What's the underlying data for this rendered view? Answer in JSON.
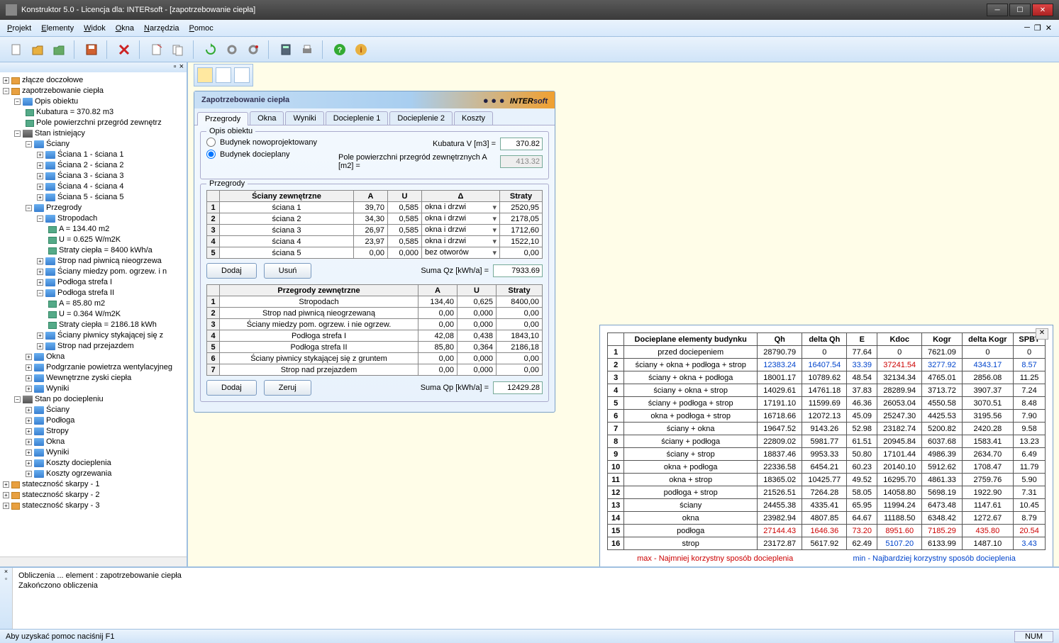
{
  "title": "Konstruktor 5.0 - Licencja dla: INTERsoft - [zapotrzebowanie ciepła]",
  "menu": {
    "projekt": "Projekt",
    "elementy": "Elementy",
    "widok": "Widok",
    "okna": "Okna",
    "narzedzia": "Narzędzia",
    "pomoc": "Pomoc"
  },
  "panel": {
    "title": "Zapotrzebowanie ciepła",
    "brand_a": "INTER",
    "brand_b": "soft",
    "tabs": {
      "przegrody": "Przegrody",
      "okna": "Okna",
      "wyniki": "Wyniki",
      "doc1": "Docieplenie 1",
      "doc2": "Docieplenie 2",
      "koszty": "Koszty"
    },
    "opis": {
      "title": "Opis obiektu",
      "r1": "Budynek nowoprojektowany",
      "r2": "Budynek docieplany",
      "kubatura_lbl": "Kubatura   V [m3] =",
      "kubatura": "370.82",
      "pole_lbl": "Pole powierzchni przegród zewnętrznych   A [m2] =",
      "pole": "413.32"
    },
    "prz": {
      "title": "Przegrody",
      "h1": "Ściany zewnętrzne",
      "hA": "A",
      "hU": "U",
      "hD": "Δ",
      "hS": "Straty",
      "rows": [
        {
          "n": "1",
          "name": "ściana 1",
          "a": "39,70",
          "u": "0,585",
          "d": "okna i drzwi",
          "s": "2520,95"
        },
        {
          "n": "2",
          "name": "ściana 2",
          "a": "34,30",
          "u": "0,585",
          "d": "okna i drzwi",
          "s": "2178,05"
        },
        {
          "n": "3",
          "name": "ściana 3",
          "a": "26,97",
          "u": "0,585",
          "d": "okna i drzwi",
          "s": "1712,60"
        },
        {
          "n": "4",
          "name": "ściana 4",
          "a": "23,97",
          "u": "0,585",
          "d": "okna i drzwi",
          "s": "1522,10"
        },
        {
          "n": "5",
          "name": "ściana 5",
          "a": "0,00",
          "u": "0,000",
          "d": "bez otworów",
          "s": "0,00"
        }
      ],
      "dodaj": "Dodaj",
      "usun": "Usuń",
      "suma_lbl": "Suma Qz [kWh/a] =",
      "suma": "7933.69",
      "h2": "Przegrody zewnętrzne",
      "rows2": [
        {
          "n": "1",
          "name": "Stropodach",
          "a": "134,40",
          "u": "0,625",
          "s": "8400,00"
        },
        {
          "n": "2",
          "name": "Strop nad piwnicą nieogrzewaną",
          "a": "0,00",
          "u": "0,000",
          "s": "0,00"
        },
        {
          "n": "3",
          "name": "Ściany miedzy pom. ogrzew. i nie ogrzew.",
          "a": "0,00",
          "u": "0,000",
          "s": "0,00"
        },
        {
          "n": "4",
          "name": "Podłoga strefa I",
          "a": "42,08",
          "u": "0,438",
          "s": "1843,10"
        },
        {
          "n": "5",
          "name": "Podłoga strefa II",
          "a": "85,80",
          "u": "0,364",
          "s": "2186,18"
        },
        {
          "n": "6",
          "name": "Ściany piwnicy stykającej się z gruntem",
          "a": "0,00",
          "u": "0,000",
          "s": "0,00"
        },
        {
          "n": "7",
          "name": "Strop nad przejazdem",
          "a": "0,00",
          "u": "0,000",
          "s": "0,00"
        }
      ],
      "zeruj": "Zeruj",
      "suma2_lbl": "Suma Qp [kWh/a] =",
      "suma2": "12429.28"
    }
  },
  "tree": {
    "n1": "złącze doczołowe",
    "n2": "zapotrzebowanie ciepła",
    "n3": "Opis obiektu",
    "n4": "Kubatura = 370.82 m3",
    "n5": "Pole powierzchni przegród zewnętrz",
    "n6": "Stan istniejący",
    "n7": "Ściany",
    "s1": "Ściana 1 - ściana 1",
    "s2": "Ściana 2 - ściana 2",
    "s3": "Ściana 3 - ściana 3",
    "s4": "Ściana 4 - ściana 4",
    "s5": "Ściana 5 - ściana 5",
    "n8": "Przegrody",
    "n9": "Stropodach",
    "n9a": "A = 134.40 m2",
    "n9b": "U = 0.625 W/m2K",
    "n9c": "Straty ciepła = 8400 kWh/a",
    "n10": "Strop nad piwnicą nieogrzewa",
    "n11": "Ściany miedzy pom. ogrzew. i n",
    "n12": "Podłoga strefa I",
    "n13": "Podłoga strefa II",
    "n13a": "A = 85.80 m2",
    "n13b": "U = 0.364 W/m2K",
    "n13c": "Straty ciepła = 2186.18 kWh",
    "n14": "Ściany piwnicy stykającej się z",
    "n15": "Strop nad przejazdem",
    "n16": "Okna",
    "n17": "Podgrzanie powietrza wentylacyjneg",
    "n18": "Wewnętrzne zyski ciepła",
    "n19": "Wyniki",
    "n20": "Stan po dociepleniu",
    "n21": "Ściany",
    "n22": "Podłoga",
    "n23": "Stropy",
    "n24": "Okna",
    "n25": "Wyniki",
    "n26": "Koszty docieplenia",
    "n27": "Koszty ogrzewania",
    "n28": "stateczność skarpy - 1",
    "n29": "stateczność skarpy - 2",
    "n30": "stateczność skarpy - 3"
  },
  "results": {
    "headers": {
      "el": "Docieplane elementy budynku",
      "qh": "Qh",
      "dqh": "delta Qh",
      "e": "E",
      "kdoc": "Kdoc",
      "kogr": "Kogr",
      "dkogr": "delta Kogr",
      "spbt": "SPBT"
    },
    "rows": [
      {
        "n": "1",
        "el": "przed dociepeniem",
        "qh": "28790.79",
        "dqh": "0",
        "e": "77.64",
        "kdoc": "0",
        "kogr": "7621.09",
        "dkogr": "0",
        "spbt": "0"
      },
      {
        "n": "2",
        "el": "ściany + okna + podłoga + strop",
        "qh": "12383.24",
        "dqh": "16407.54",
        "e": "33.39",
        "kdoc": "37241.54",
        "kogr": "3277.92",
        "dkogr": "4343.17",
        "spbt": "8.57",
        "cls": "blue",
        "kdoc_cls": "red"
      },
      {
        "n": "3",
        "el": "ściany + okna + podłoga",
        "qh": "18001.17",
        "dqh": "10789.62",
        "e": "48.54",
        "kdoc": "32134.34",
        "kogr": "4765.01",
        "dkogr": "2856.08",
        "spbt": "11.25"
      },
      {
        "n": "4",
        "el": "ściany + okna + strop",
        "qh": "14029.61",
        "dqh": "14761.18",
        "e": "37.83",
        "kdoc": "28289.94",
        "kogr": "3713.72",
        "dkogr": "3907.37",
        "spbt": "7.24"
      },
      {
        "n": "5",
        "el": "ściany + podłoga + strop",
        "qh": "17191.10",
        "dqh": "11599.69",
        "e": "46.36",
        "kdoc": "26053.04",
        "kogr": "4550.58",
        "dkogr": "3070.51",
        "spbt": "8.48"
      },
      {
        "n": "6",
        "el": "okna + podłoga + strop",
        "qh": "16718.66",
        "dqh": "12072.13",
        "e": "45.09",
        "kdoc": "25247.30",
        "kogr": "4425.53",
        "dkogr": "3195.56",
        "spbt": "7.90"
      },
      {
        "n": "7",
        "el": "ściany + okna",
        "qh": "19647.52",
        "dqh": "9143.26",
        "e": "52.98",
        "kdoc": "23182.74",
        "kogr": "5200.82",
        "dkogr": "2420.28",
        "spbt": "9.58"
      },
      {
        "n": "8",
        "el": "ściany + podłoga",
        "qh": "22809.02",
        "dqh": "5981.77",
        "e": "61.51",
        "kdoc": "20945.84",
        "kogr": "6037.68",
        "dkogr": "1583.41",
        "spbt": "13.23"
      },
      {
        "n": "9",
        "el": "ściany + strop",
        "qh": "18837.46",
        "dqh": "9953.33",
        "e": "50.80",
        "kdoc": "17101.44",
        "kogr": "4986.39",
        "dkogr": "2634.70",
        "spbt": "6.49"
      },
      {
        "n": "10",
        "el": "okna + podłoga",
        "qh": "22336.58",
        "dqh": "6454.21",
        "e": "60.23",
        "kdoc": "20140.10",
        "kogr": "5912.62",
        "dkogr": "1708.47",
        "spbt": "11.79"
      },
      {
        "n": "11",
        "el": "okna + strop",
        "qh": "18365.02",
        "dqh": "10425.77",
        "e": "49.52",
        "kdoc": "16295.70",
        "kogr": "4861.33",
        "dkogr": "2759.76",
        "spbt": "5.90"
      },
      {
        "n": "12",
        "el": "podłoga + strop",
        "qh": "21526.51",
        "dqh": "7264.28",
        "e": "58.05",
        "kdoc": "14058.80",
        "kogr": "5698.19",
        "dkogr": "1922.90",
        "spbt": "7.31"
      },
      {
        "n": "13",
        "el": "ściany",
        "qh": "24455.38",
        "dqh": "4335.41",
        "e": "65.95",
        "kdoc": "11994.24",
        "kogr": "6473.48",
        "dkogr": "1147.61",
        "spbt": "10.45"
      },
      {
        "n": "14",
        "el": "okna",
        "qh": "23982.94",
        "dqh": "4807.85",
        "e": "64.67",
        "kdoc": "11188.50",
        "kogr": "6348.42",
        "dkogr": "1272.67",
        "spbt": "8.79"
      },
      {
        "n": "15",
        "el": "podłoga",
        "qh": "27144.43",
        "dqh": "1646.36",
        "e": "73.20",
        "kdoc": "8951.60",
        "kogr": "7185.29",
        "dkogr": "435.80",
        "spbt": "20.54",
        "cls": "red"
      },
      {
        "n": "16",
        "el": "strop",
        "qh": "23172.87",
        "dqh": "5617.92",
        "e": "62.49",
        "kdoc": "5107.20",
        "kogr": "6133.99",
        "dkogr": "1487.10",
        "spbt": "3.43",
        "kdoc_cls": "blue",
        "spbt_cls": "blue"
      }
    ],
    "legend_max": "max - Najmniej korzystny sposób docieplenia",
    "legend_min": "min - Najbardziej korzystny sposób docieplenia"
  },
  "log": {
    "l1": "Obliczenia ... element : zapotrzebowanie ciepła",
    "l2": "Zakończono obliczenia"
  },
  "status": {
    "help": "Aby uzyskać pomoc naciśnij F1",
    "num": "NUM"
  }
}
